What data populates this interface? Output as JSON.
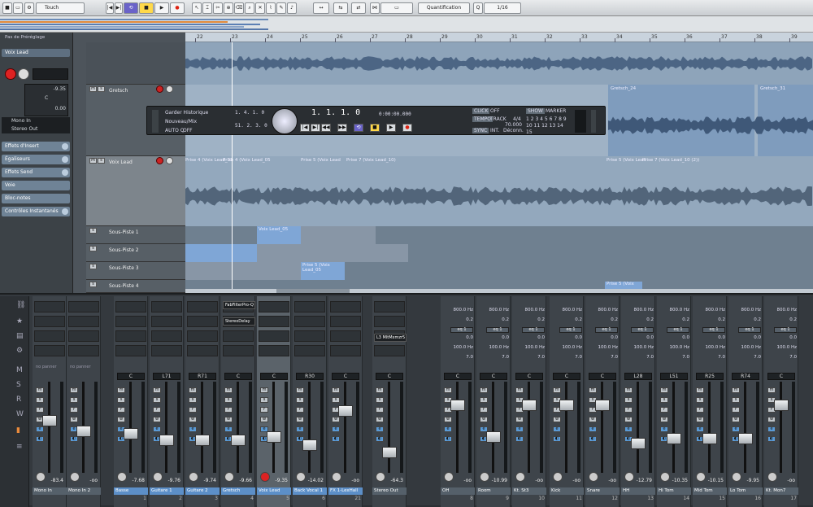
{
  "toolbar": {
    "automation_mode": "Touch",
    "quantize_label": "Quantification",
    "quantize_value": "1/16"
  },
  "inspector": {
    "preset_label": "Pas de Préréglage",
    "track_name": "Voix Lead",
    "volume": "-9.35",
    "pan": "C",
    "delay": "0.00",
    "input": "Mono In",
    "output": "Stereo Out",
    "sections": [
      "Effets d'Insert",
      "Égaliseurs",
      "Effets Send",
      "Voie",
      "Bloc-notes",
      "Contrôles Instantanés"
    ]
  },
  "tracks": {
    "gretsch": "Gretsch",
    "voix_lead": "Voix Lead",
    "sous_pistes": [
      "Sous-Piste 1",
      "Sous-Piste 2",
      "Sous-Piste 3",
      "Sous-Piste 4"
    ]
  },
  "ruler": [
    "22",
    "23",
    "24",
    "25",
    "26",
    "27",
    "28",
    "29",
    "30",
    "31",
    "32",
    "33",
    "34",
    "35",
    "36",
    "37",
    "38",
    "39"
  ],
  "events": {
    "gretsch_a": "Gretsch_24",
    "gretsch_b": "Gretsch_31",
    "voix_row": [
      "Prise 4 (Voix Lead_05",
      "Prise 4 (Voix Lead_05",
      "Prise 5 (Voix Lead",
      "Prise 7 (Voix Lead_10)",
      "Prise 5 (Voix Lead",
      "Prise 7 (Voix Lead_10 (2))"
    ],
    "sp1": [
      "Voix Lead_05"
    ],
    "sp3": [
      "Prise 5 (Voix Lead_05"
    ],
    "sp4": "Prise 5 (Voix"
  },
  "transport": {
    "history": "Garder Historique",
    "new_mix": "Nouveau/Mix",
    "auto_q": "AUTO Q",
    "off": "OFF",
    "pos_left": "1. 4. 1.   0",
    "pos_left2": "51. 2. 3.   0",
    "position": "1. 1. 1.   0",
    "time": "0:00:00.000",
    "click": "CLICK",
    "click_state": "OFF",
    "tempo": "TEMPO",
    "track": "TRACK",
    "signature": "4/4",
    "bpm": "70.000",
    "sync": "SYNC",
    "int": "INT.",
    "deconn": "Déconn.",
    "show": "SHOW",
    "markers": "MARKER",
    "marker_nums": "1 2 3 4 5 6 7 8 9 10 11 12 13 14 15"
  },
  "mixer": {
    "strips": [
      {
        "name": "Mono In",
        "num": "",
        "vol": "-83.4",
        "pan": "C",
        "label": "no panner",
        "blue": false
      },
      {
        "name": "Mono In 2",
        "num": "",
        "vol": "-oo",
        "pan": "C",
        "label": "no panner",
        "blue": false
      },
      {
        "name": "Basse",
        "num": "1",
        "vol": "-7.68",
        "pan": "C",
        "label": "",
        "blue": true
      },
      {
        "name": "Guitare 1",
        "num": "2",
        "vol": "-9.76",
        "pan": "L71",
        "label": "",
        "blue": true
      },
      {
        "name": "Guitare 2",
        "num": "3",
        "vol": "-9.74",
        "pan": "R71",
        "label": "",
        "blue": true
      },
      {
        "name": "Gretsch",
        "num": "4",
        "vol": "-9.66",
        "pan": "C",
        "label": "",
        "blue": true
      },
      {
        "name": "Voix Lead",
        "num": "5",
        "vol": "-9.35",
        "pan": "C",
        "label": "",
        "blue": true
      },
      {
        "name": "Back Vocal 1",
        "num": "6",
        "vol": "-14.02",
        "pan": "R30",
        "label": "",
        "blue": true
      },
      {
        "name": "FX 1-LexHall",
        "num": "21",
        "vol": "-oo",
        "pan": "C",
        "label": "",
        "blue": true
      },
      {
        "name": "Stereo Out",
        "num": "",
        "vol": "-64.3",
        "pan": "C",
        "label": "",
        "blue": false
      },
      {
        "name": "OH",
        "num": "8",
        "vol": "-oo",
        "pan": "C",
        "label": "",
        "blue": false
      },
      {
        "name": "Room",
        "num": "9",
        "vol": "-10.99",
        "pan": "C",
        "label": "",
        "blue": false
      },
      {
        "name": "Kt. St3",
        "num": "10",
        "vol": "-oo",
        "pan": "C",
        "label": "",
        "blue": false
      },
      {
        "name": "Kick",
        "num": "11",
        "vol": "-oo",
        "pan": "C",
        "label": "",
        "blue": false
      },
      {
        "name": "Snare",
        "num": "12",
        "vol": "-oo",
        "pan": "C",
        "label": "",
        "blue": false
      },
      {
        "name": "HH",
        "num": "13",
        "vol": "-12.79",
        "pan": "L28",
        "label": "",
        "blue": false
      },
      {
        "name": "Hi Tom",
        "num": "14",
        "vol": "-10.35",
        "pan": "L51",
        "label": "",
        "blue": false
      },
      {
        "name": "Mid Tom",
        "num": "15",
        "vol": "-10.15",
        "pan": "R25",
        "label": "",
        "blue": false
      },
      {
        "name": "Lo Tom",
        "num": "16",
        "vol": "-9.95",
        "pan": "R74",
        "label": "",
        "blue": false
      },
      {
        "name": "Kt. Mon7",
        "num": "17",
        "vol": "-oo",
        "pan": "C",
        "label": "",
        "blue": false
      }
    ],
    "inserts": [
      "FabFilterPro-Q",
      "StereoDelay",
      "L3 MltMxmzr5"
    ],
    "eq": {
      "freq1": "800.0 Hz",
      "gain1": "0.2",
      "eq_label": "eq 1",
      "gain2": "0.0",
      "freq2": "100.0 Hz",
      "q": "7.0"
    }
  }
}
